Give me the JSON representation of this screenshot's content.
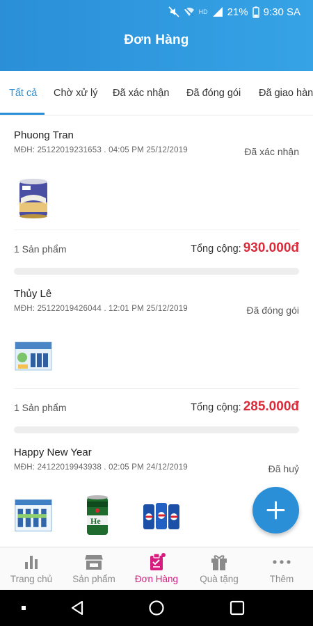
{
  "status_bar": {
    "battery": "21%",
    "time": "9:30 SA"
  },
  "header": {
    "title": "Đơn Hàng"
  },
  "tabs": [
    {
      "label": "Tất cả",
      "active": true
    },
    {
      "label": "Chờ xử lý"
    },
    {
      "label": "Đã xác nhận"
    },
    {
      "label": "Đã đóng gói"
    },
    {
      "label": "Đã giao hàn"
    }
  ],
  "orders": [
    {
      "customer": "Phuong Tran",
      "code": "MĐH: 25122019231653 . 04:05 PM 25/12/2019",
      "status": "Đã xác nhận",
      "products": [
        "milk-can"
      ],
      "quantity": "1 Sản phẩm",
      "total_label": "Tổng cộng:",
      "total": "930.000đ"
    },
    {
      "customer": "Thủy Lê",
      "code": "MĐH: 25122019426044 . 12:01 PM 25/12/2019",
      "status": "Đã đóng gói",
      "products": [
        "milk-box-pack"
      ],
      "quantity": "1 Sản phẩm",
      "total_label": "Tổng cộng:",
      "total": "285.000đ"
    },
    {
      "customer": "Happy New Year",
      "code": "MĐH: 24122019943938 . 02:05 PM 24/12/2019",
      "status": "Đã huỷ",
      "products": [
        "milk-box-pack",
        "beer-can",
        "soda-pack"
      ]
    }
  ],
  "bottom_nav": [
    {
      "label": "Trang chủ",
      "icon": "bar-chart-icon"
    },
    {
      "label": "Sản phẩm",
      "icon": "store-icon"
    },
    {
      "label": "Đơn Hàng",
      "icon": "clipboard-icon",
      "active": true
    },
    {
      "label": "Quà tặng",
      "icon": "gift-icon"
    },
    {
      "label": "Thêm",
      "icon": "more-icon"
    }
  ],
  "colors": {
    "primary": "#2a8fd7",
    "price": "#d92b3a",
    "active_nav": "#d81b7e"
  }
}
